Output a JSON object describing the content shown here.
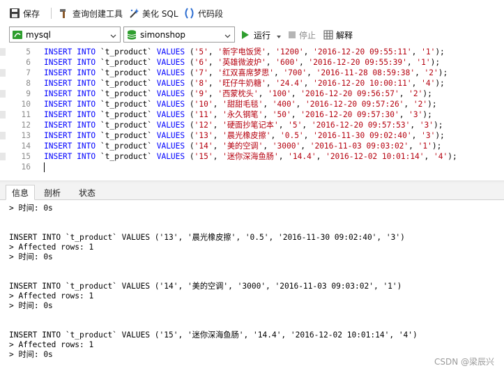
{
  "toolbar": {
    "save": "保存",
    "query_builder": "查询创建工具",
    "beautify_sql": "美化 SQL",
    "code_snippet": "代码段"
  },
  "connection_bar": {
    "connection": "mysql",
    "database": "simonshop",
    "run": "运行",
    "stop": "停止",
    "explain": "解释"
  },
  "editor": {
    "lines": [
      {
        "num": "5",
        "id": "'5'",
        "name": "'新字电饭煲'",
        "price": "'1200'",
        "date": "'2016-12-20 09:55:11'",
        "cat": "'1'"
      },
      {
        "num": "6",
        "id": "'6'",
        "name": "'英雄微波炉'",
        "price": "'600'",
        "date": "'2016-12-20 09:55:39'",
        "cat": "'1'"
      },
      {
        "num": "7",
        "id": "'7'",
        "name": "'红双喜席梦思'",
        "price": "'700'",
        "date": "'2016-11-28 08:59:38'",
        "cat": "'2'"
      },
      {
        "num": "8",
        "id": "'8'",
        "name": "'旺仔牛奶糖'",
        "price": "'24.4'",
        "date": "'2016-12-20 10:00:11'",
        "cat": "'4'"
      },
      {
        "num": "9",
        "id": "'9'",
        "name": "'西蒙枕头'",
        "price": "'100'",
        "date": "'2016-12-20 09:56:57'",
        "cat": "'2'"
      },
      {
        "num": "10",
        "id": "'10'",
        "name": "'甜甜毛毯'",
        "price": "'400'",
        "date": "'2016-12-20 09:57:26'",
        "cat": "'2'"
      },
      {
        "num": "11",
        "id": "'11'",
        "name": "'永久钢笔'",
        "price": "'50'",
        "date": "'2016-12-20 09:57:30'",
        "cat": "'3'"
      },
      {
        "num": "12",
        "id": "'12'",
        "name": "'硬面抄笔记本'",
        "price": "'5'",
        "date": "'2016-12-20 09:57:53'",
        "cat": "'3'"
      },
      {
        "num": "13",
        "id": "'13'",
        "name": "'晨光橡皮擦'",
        "price": "'0.5'",
        "date": "'2016-11-30 09:02:40'",
        "cat": "'3'"
      },
      {
        "num": "14",
        "id": "'14'",
        "name": "'美的空调'",
        "price": "'3000'",
        "date": "'2016-11-03 09:03:02'",
        "cat": "'1'"
      },
      {
        "num": "15",
        "id": "'15'",
        "name": "'迷你深海鱼肠'",
        "price": "'14.4'",
        "date": "'2016-12-02 10:01:14'",
        "cat": "'4'"
      }
    ],
    "last_line_num": "16",
    "keyword_insert": "INSERT",
    "keyword_into": "INTO",
    "table_name": "`t_product`",
    "keyword_values": "VALUES"
  },
  "result_tabs": [
    "信息",
    "剖析",
    "状态"
  ],
  "messages": {
    "lines": [
      "> 时间: 0s",
      "",
      "",
      "INSERT INTO `t_product` VALUES ('13', '晨光橡皮擦', '0.5', '2016-11-30 09:02:40', '3')",
      "> Affected rows: 1",
      "> 时间: 0s",
      "",
      "",
      "INSERT INTO `t_product` VALUES ('14', '美的空调', '3000', '2016-11-03 09:03:02', '1')",
      "> Affected rows: 1",
      "> 时间: 0s",
      "",
      "",
      "INSERT INTO `t_product` VALUES ('15', '迷你深海鱼肠', '14.4', '2016-12-02 10:01:14', '4')",
      "> Affected rows: 1",
      "> 时间: 0s"
    ]
  },
  "watermark": "CSDN @梁辰兴",
  "colors": {
    "keyword": "#0000ff",
    "string": "#b5000e",
    "line_number": "#8a8a8a",
    "run_green": "#2e9e2e"
  }
}
